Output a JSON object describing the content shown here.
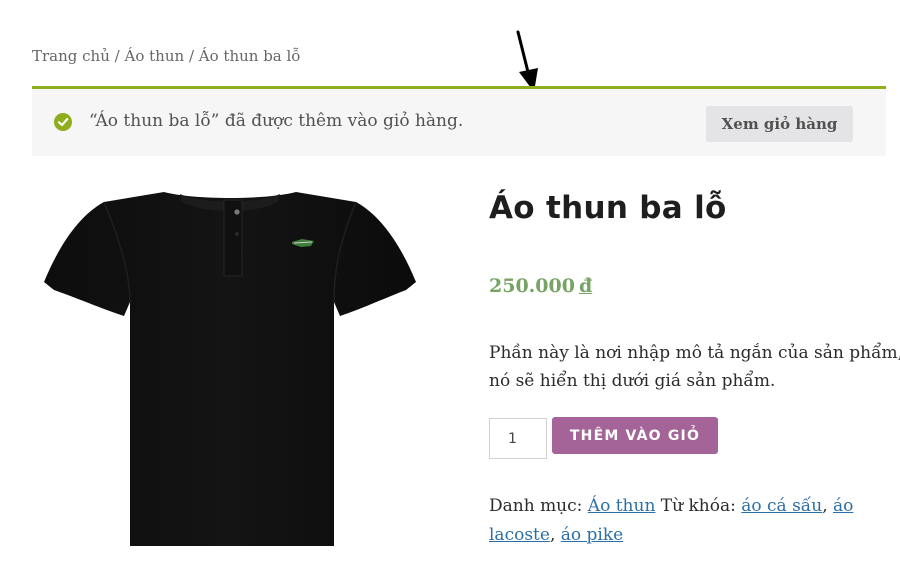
{
  "breadcrumb": {
    "home": "Trang chủ",
    "category": "Áo thun",
    "current": "Áo thun ba lỗ",
    "separator": "/"
  },
  "notice": {
    "message": "“Áo thun ba lỗ” đã được thêm vào giỏ hàng.",
    "view_cart_label": "Xem giỏ hàng",
    "icon": "check-circle-icon",
    "accent_color": "#8fae1b"
  },
  "product": {
    "image": "black-polo-shirt",
    "title": "Áo thun ba lỗ",
    "price_value": "250.000",
    "currency": "đ",
    "price_color": "#77a464",
    "description_line1": "Phần này là nơi nhập mô tả ngắn của sản phẩm,",
    "description_line2": "nó sẽ hiển thị dưới giá sản phẩm.",
    "quantity": "1",
    "add_to_cart_label": "THÊM VÀO GIỎ",
    "button_color": "#a46497"
  },
  "meta": {
    "category_label": "Danh mục:",
    "category": "Áo thun",
    "tags_label": "Từ khóa:",
    "tags": [
      "áo cá sấu",
      "áo lacoste",
      "áo pike"
    ],
    "tag_separator": ","
  }
}
